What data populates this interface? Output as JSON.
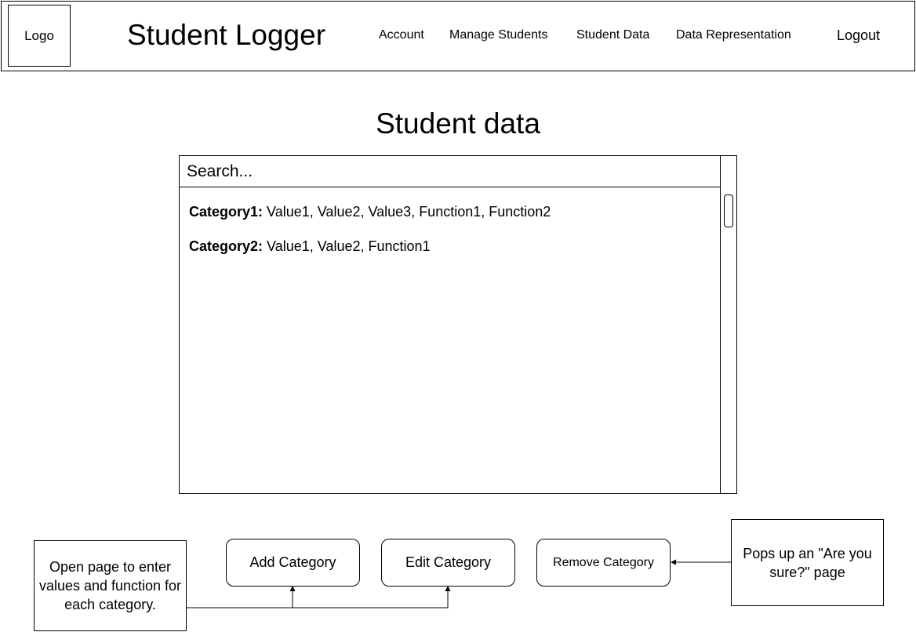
{
  "header": {
    "logo": "Logo",
    "title": "Student Logger",
    "nav": {
      "account": "Account",
      "manage_students": "Manage Students",
      "student_data": "Student Data",
      "data_representation": "Data Representation",
      "logout": "Logout"
    }
  },
  "page_title": "Student data",
  "search": {
    "placeholder": "Search..."
  },
  "categories": [
    {
      "name": "Category1:",
      "values": "Value1, Value2, Value3, Function1, Function2"
    },
    {
      "name": "Category2:",
      "values": "Value1, Value2, Function1"
    }
  ],
  "buttons": {
    "add": "Add Category",
    "edit": "Edit Category",
    "remove": "Remove Category"
  },
  "annotations": {
    "left": "Open page to enter values and function for each category.",
    "right": "Pops up an \"Are you sure?\" page"
  }
}
